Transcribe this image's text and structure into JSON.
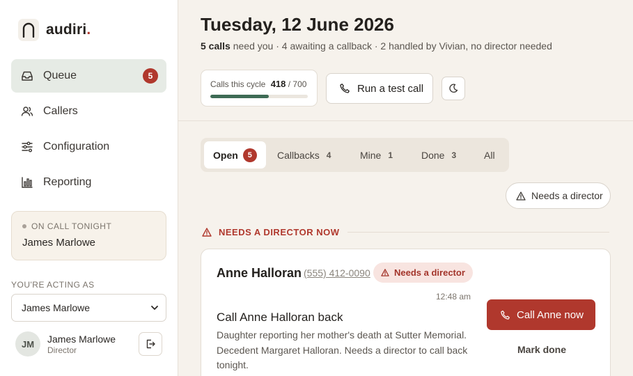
{
  "brand": {
    "name": "audiri",
    "dot": "."
  },
  "nav": {
    "items": [
      {
        "label": "Queue",
        "badge": "5"
      },
      {
        "label": "Callers"
      },
      {
        "label": "Configuration"
      },
      {
        "label": "Reporting"
      }
    ]
  },
  "on_call": {
    "title": "ON CALL TONIGHT",
    "name": "James Marlowe"
  },
  "acting_as": {
    "label": "YOU'RE ACTING AS",
    "selected": "James Marlowe"
  },
  "user": {
    "initials": "JM",
    "name": "James Marlowe",
    "role": "Director"
  },
  "header": {
    "title": "Tuesday, 12 June 2026",
    "subtitle_bold": "5 calls",
    "subtitle_rest": " need you · 4 awaiting a callback · 2 handled by Vivian, no director needed"
  },
  "cycle": {
    "label": "Calls this cycle",
    "used": "418",
    "total": "/ 700",
    "progress_fraction": 0.597
  },
  "actions": {
    "test_call": "Run a test call"
  },
  "tabs": [
    {
      "label": "Open",
      "count": "5"
    },
    {
      "label": "Callbacks",
      "count": "4"
    },
    {
      "label": "Mine",
      "count": "1"
    },
    {
      "label": "Done",
      "count": "3"
    },
    {
      "label": "All"
    }
  ],
  "filter": {
    "label": "Needs a director"
  },
  "section": {
    "label": "NEEDS A DIRECTOR NOW"
  },
  "card": {
    "caller_name": "Anne Halloran",
    "phone": "(555) 412-0090",
    "flag": "Needs a director",
    "time": "12:48 am",
    "title": "Call Anne Halloran back",
    "body": "Daughter reporting her mother's death at Sutter Memorial. Decedent Margaret Halloran. Needs a director to call back tonight.",
    "call_label": "Call Anne now",
    "done_label": "Mark done"
  },
  "colors": {
    "accent": "#b0382d",
    "progress": "#3e6b55",
    "nav_active": "#e6ebe5"
  }
}
